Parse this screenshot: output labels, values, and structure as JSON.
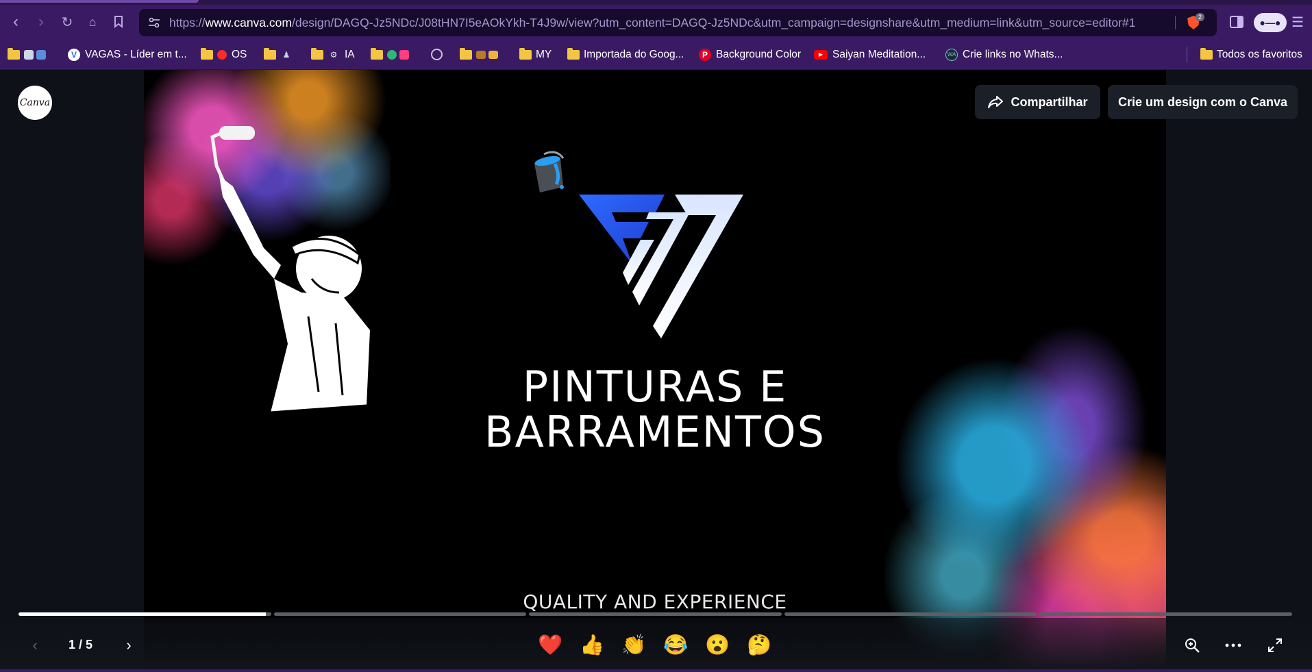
{
  "browser": {
    "url_prefix": "https://",
    "url_domain": "www.canva.com",
    "url_path": "/design/DAGQ-Jz5NDc/J08tHN7I5eAOkYkh-T4J9w/view?utm_content=DAGQ-Jz5NDc&utm_campaign=designshare&utm_medium=link&utm_source=editor#1",
    "brave_badge_count": "2"
  },
  "bookmarks": {
    "vagas": "VAGAS - Líder em t...",
    "os": "OS",
    "ia": "IA",
    "my": "MY",
    "importada": "Importada do Goog...",
    "background_color": "Background Color",
    "saiyan": "Saiyan Meditation...",
    "crie_links": "Crie links no Whats...",
    "todos": "Todos os favoritos"
  },
  "viewer": {
    "logo_text": "Canva",
    "share_label": "Compartilhar",
    "create_label": "Crie um design com o Canva",
    "page_counter": "1 / 5",
    "current_page": 1,
    "total_pages": 5,
    "current_page_progress": 0.98
  },
  "slide": {
    "title_line1": "PINTURAS E",
    "title_line2": "BARRAMENTOS",
    "subtitle": "QUALITY AND EXPERIENCE"
  },
  "reactions": [
    {
      "name": "heart",
      "glyph": "❤️"
    },
    {
      "name": "thumbs-up",
      "glyph": "👍"
    },
    {
      "name": "clapping",
      "glyph": "👏"
    },
    {
      "name": "laughing",
      "glyph": "😂"
    },
    {
      "name": "surprised",
      "glyph": "😮"
    },
    {
      "name": "thinking",
      "glyph": "🤔"
    }
  ],
  "colors": {
    "chrome_purple": "#3a1b63",
    "viewer_bg": "#0e1118",
    "logo_blue": "#2f6bff",
    "logo_white": "#eef3ff"
  }
}
